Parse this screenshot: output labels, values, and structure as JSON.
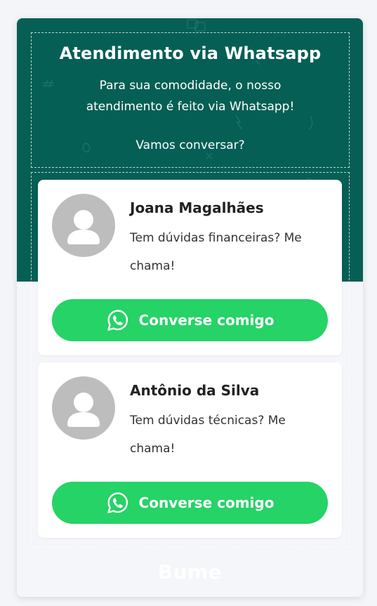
{
  "header": {
    "title": "Atendimento via Whatsapp",
    "subtitle": "Para sua comodidade, o nosso atendimento é feito via Whatsapp!",
    "cta": "Vamos conversar?"
  },
  "agents": [
    {
      "name": "Joana Magalhães",
      "description": "Tem dúvidas financeiras? Me chama!",
      "button_label": "Converse comigo"
    },
    {
      "name": "Antônio da Silva",
      "description": "Tem dúvidas técnicas? Me chama!",
      "button_label": "Converse comigo"
    }
  ],
  "footer": {
    "brand": "Bume"
  },
  "colors": {
    "header_bg": "#065f55",
    "button_bg": "#25d366",
    "avatar_bg": "#bdbdbd",
    "page_bg": "#f4f5f8"
  },
  "icons": {
    "avatar": "user-silhouette-icon",
    "button": "whatsapp-icon"
  }
}
